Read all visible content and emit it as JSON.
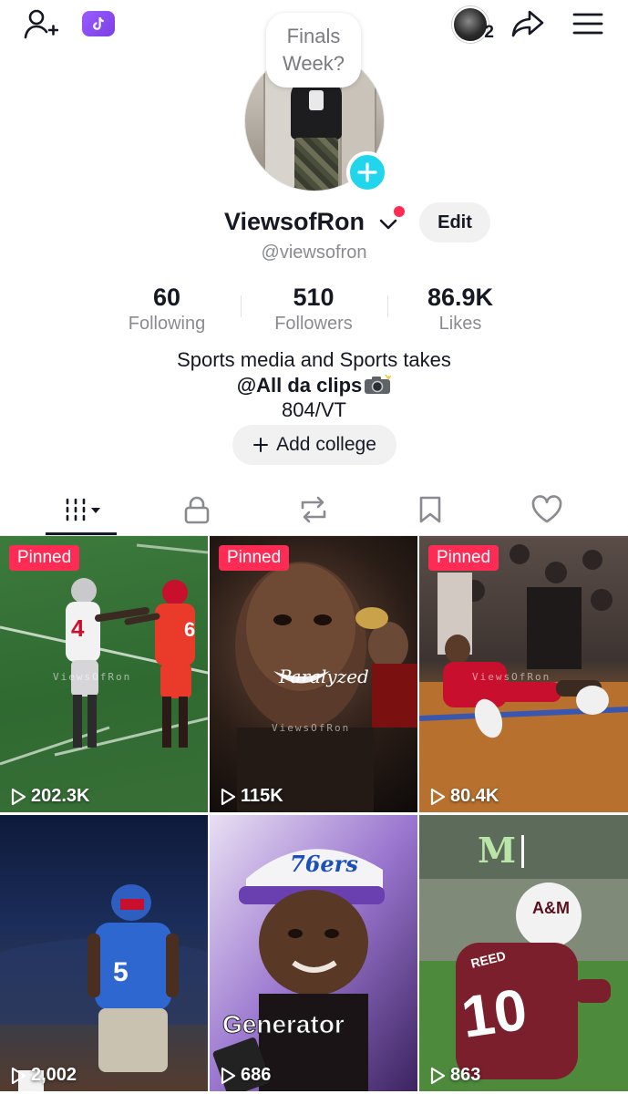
{
  "header": {
    "story_count": "2"
  },
  "avatar": {
    "note_line1": "Finals",
    "note_line2": "Week?"
  },
  "profile": {
    "display_name": "ViewsofRon",
    "edit_label": "Edit",
    "username": "@viewsofron"
  },
  "stats": {
    "following": {
      "value": "60",
      "label": "Following"
    },
    "followers": {
      "value": "510",
      "label": "Followers"
    },
    "likes": {
      "value": "86.9K",
      "label": "Likes"
    }
  },
  "bio": {
    "line1": "Sports media and Sports takes",
    "line2": "@All da clips",
    "line3": "804/VT"
  },
  "add_college_label": "Add college",
  "tabs": [
    "videos",
    "private",
    "reposts",
    "favorites",
    "liked"
  ],
  "videos": [
    {
      "pinned": "Pinned",
      "views": "202.3K",
      "watermark": "ViewsOfRon"
    },
    {
      "pinned": "Pinned",
      "views": "115K",
      "caption": "Paralyzed",
      "watermark": "ViewsOfRon"
    },
    {
      "pinned": "Pinned",
      "views": "80.4K",
      "watermark": "ViewsOfRon"
    },
    {
      "views": "2,002"
    },
    {
      "views": "686",
      "caption": "Generator",
      "hat_text": "76ers"
    },
    {
      "views": "863",
      "jersey_name": "REED",
      "jersey_number": "10"
    }
  ],
  "colors": {
    "accent_red": "#fe2c55",
    "story_cyan": "#20d5ec",
    "text_primary": "#161823",
    "text_secondary": "#8a8b91"
  }
}
